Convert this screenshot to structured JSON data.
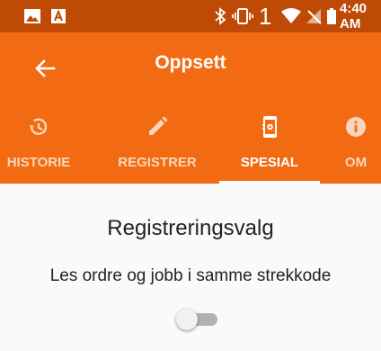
{
  "status_bar": {
    "notification_count": "1",
    "time": "4:40 AM",
    "icons": [
      "image-icon",
      "a-icon",
      "bluetooth-icon",
      "vibrate-icon",
      "wifi-icon",
      "no-signal-icon",
      "battery-icon"
    ]
  },
  "app_bar": {
    "title": "Oppsett",
    "back_icon": "back-arrow-icon"
  },
  "tabs": [
    {
      "label": "HISTORIE",
      "icon": "history-icon",
      "selected": false
    },
    {
      "label": "REGISTRER",
      "icon": "edit-icon",
      "selected": false
    },
    {
      "label": "SPESIAL",
      "icon": "mobile-settings-icon",
      "selected": true
    },
    {
      "label": "OM",
      "icon": "info-icon",
      "selected": false
    }
  ],
  "content": {
    "section_title": "Registreringsvalg",
    "setting_label": "Les ordre og jobb i samme strekkode",
    "toggle_on": false
  },
  "colors": {
    "primary": "#f26b12",
    "status_bar": "#bf4a06"
  }
}
